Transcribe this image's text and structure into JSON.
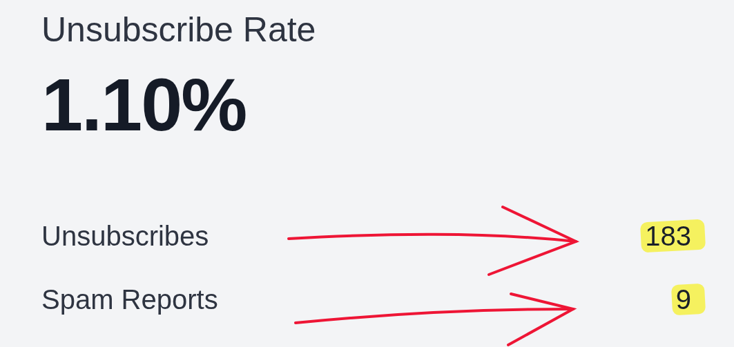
{
  "card": {
    "title": "Unsubscribe Rate",
    "value": "1.10%",
    "rows": [
      {
        "label": "Unsubscribes",
        "value": "183"
      },
      {
        "label": "Spam Reports",
        "value": "9"
      }
    ]
  }
}
